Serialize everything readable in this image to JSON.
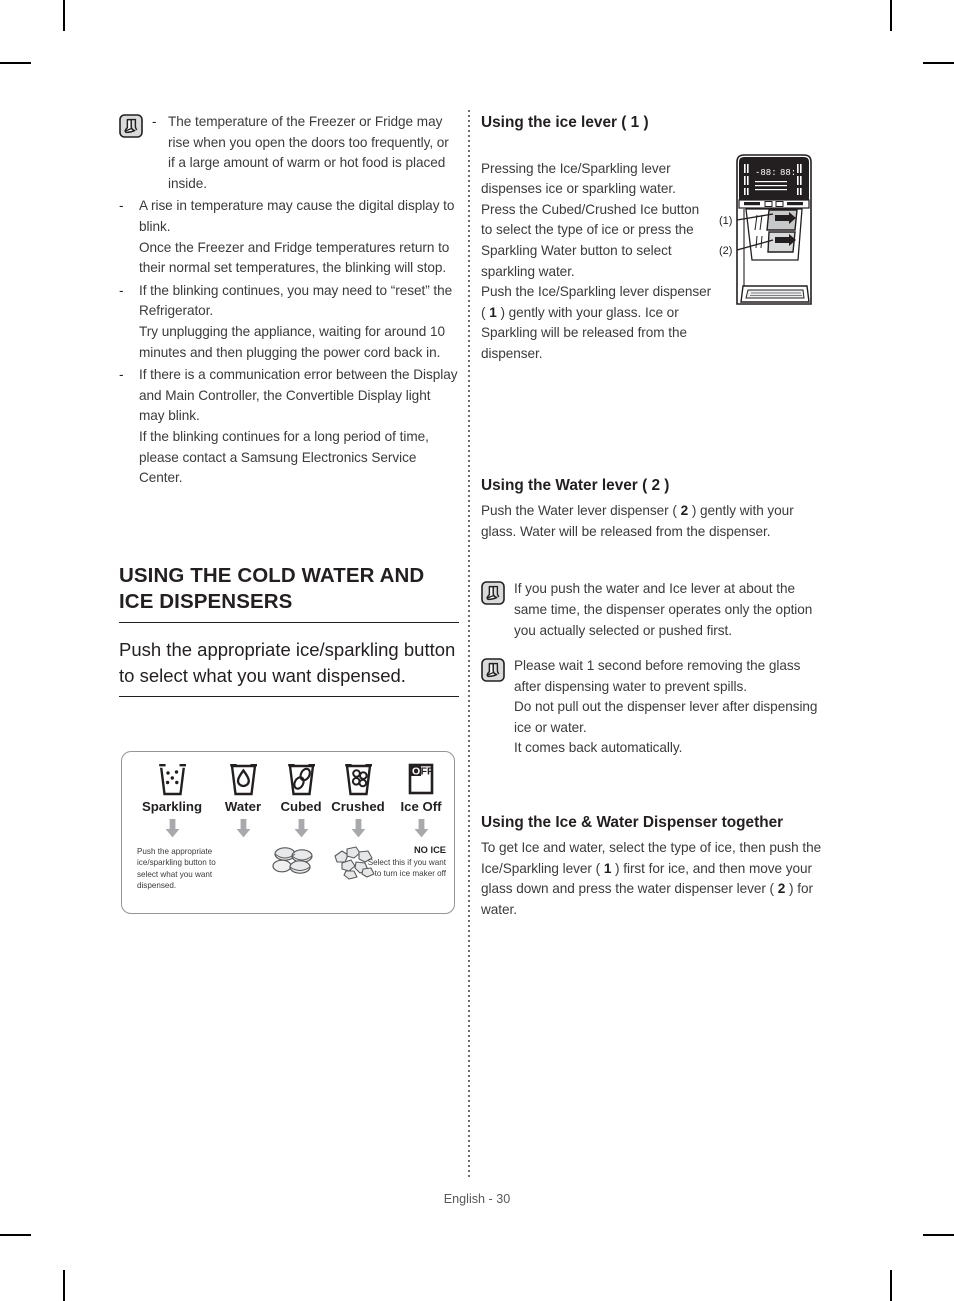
{
  "page": {
    "footer": "English - 30"
  },
  "left_column": {
    "note_top": {
      "icon": "note-pen-icon",
      "items": [
        "The temperature of the Freezer or Fridge may rise when you open the doors too frequently, or if a large amount of warm or hot food is placed inside."
      ]
    },
    "bullets": [
      "A rise in temperature may cause the digital display to blink.\nOnce the Freezer and Fridge temperatures return to their normal set temperatures, the blinking will stop.",
      "If the blinking continues, you may need to “reset” the Refrigerator.\nTry unplugging the appliance, waiting for around 10 minutes and then plugging the power cord back in.",
      "If there is a communication error between the Display and Main Controller, the Convertible Display light may blink.\nIf the blinking continues for a long period of time, please contact a Samsung Electronics Service Center."
    ],
    "dash_mark": "-",
    "section_title": "USING THE COLD WATER AND ICE DISPENSERS",
    "section_subtitle": "Push the appropriate ice/sparkling button to select what you want dispensed.",
    "option_diagram": {
      "options": [
        {
          "label": "Sparkling",
          "icon": "glass-sparkling-icon"
        },
        {
          "label": "Water",
          "icon": "glass-water-drop-icon"
        },
        {
          "label": "Cubed",
          "icon": "glass-cubed-ice-icon"
        },
        {
          "label": "Crushed",
          "icon": "glass-crushed-ice-icon"
        },
        {
          "label": "Ice Off",
          "icon": "ice-off-icon"
        }
      ],
      "arrow_icon": "down-arrow-icon",
      "caption_left": "Push the appropriate ice/sparkling button to select what you want dispensed.",
      "result_cubed_icon": "cubed-ice-pile-icon",
      "result_crushed_icon": "crushed-ice-pile-icon",
      "no_ice_title": "NO ICE",
      "no_ice_caption": "Select this if you want to turn ice maker off"
    }
  },
  "right_column": {
    "ice_lever": {
      "heading": "Using the ice lever ( 1 )",
      "body": "Pressing the Ice/Sparkling lever dispenses ice or sparkling water. Press the Cubed/Crushed Ice button to select the type of ice or press the Sparkling Water button to select sparkling water.\nPush the Ice/Sparkling lever dispenser ( 1 ) gently with your glass. Ice or Sparkling will be released from the dispenser.",
      "figure": {
        "icon": "refrigerator-dispenser-illustration",
        "callout_1": "(1)",
        "callout_2": "(2)",
        "display_left_value": "-88:",
        "display_right_value": "88:"
      }
    },
    "water_lever": {
      "heading": "Using the Water lever ( 2 )",
      "body": "Push the Water lever dispenser ( 2 ) gently with your glass. Water will be released from the dispenser."
    },
    "notes": [
      {
        "icon": "note-pen-icon",
        "text": "If you push the water and Ice lever at about the same time, the dispenser operates only the option you actually selected or pushed first."
      },
      {
        "icon": "note-pen-icon",
        "text": "Please wait 1 second before removing the glass after dispensing water to prevent spills.\nDo not pull out the dispenser lever after dispensing ice or water.\nIt comes back automatically."
      }
    ],
    "together": {
      "heading": "Using the Ice & Water Dispenser together",
      "body": "To get Ice and water, select the type of ice, then push the Ice/Sparkling lever ( 1 ) first for ice, and then move your glass down and press the water dispenser lever ( 2 ) for water."
    }
  }
}
